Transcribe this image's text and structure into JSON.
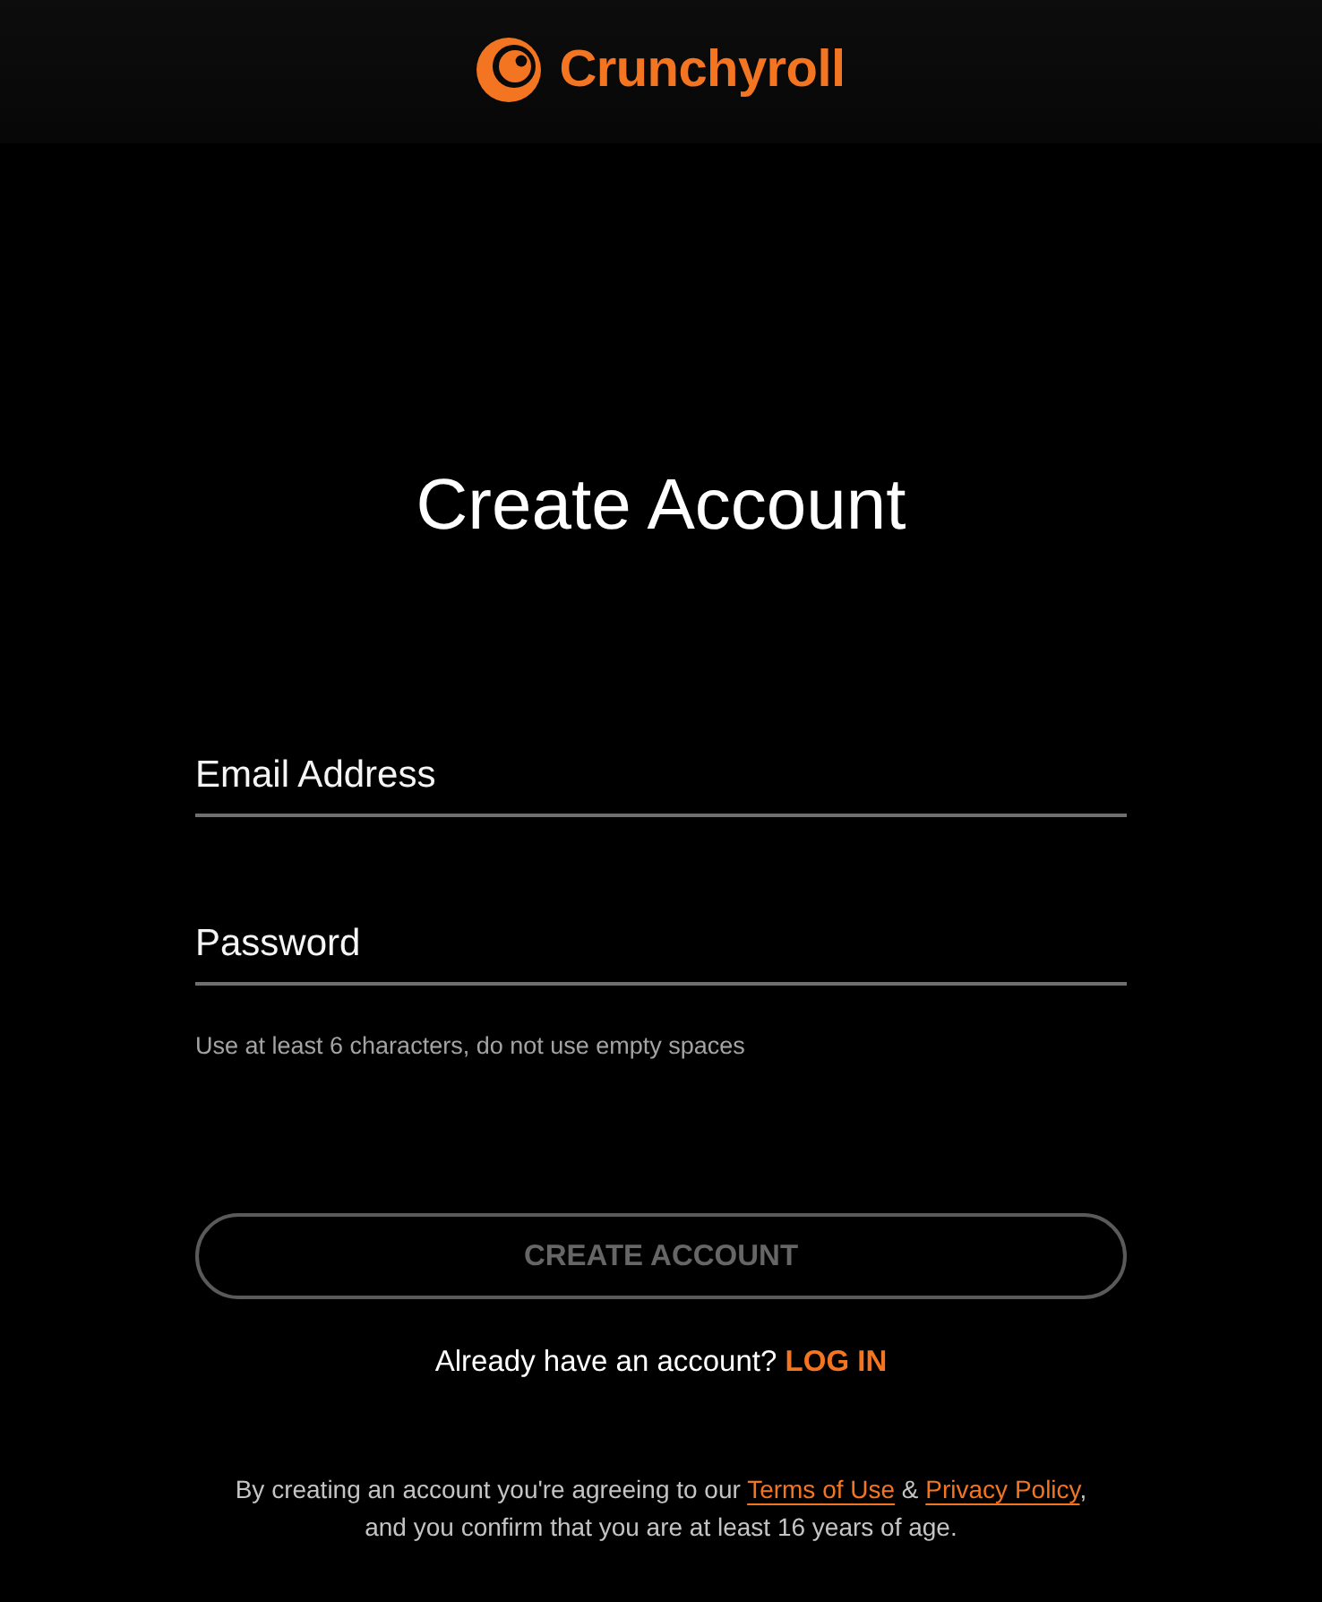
{
  "header": {
    "brand": "Crunchyroll"
  },
  "title": "Create Account",
  "form": {
    "fields": [
      {
        "placeholder": "Email Address"
      },
      {
        "placeholder": "Password"
      }
    ],
    "hint": "Use at least 6 characters, do not use empty spaces"
  },
  "create_button": {
    "label": "CREATE ACCOUNT",
    "disabled": true
  },
  "login_prompt": {
    "text": "Already have an account?",
    "link": "LOG IN"
  },
  "legal": {
    "lines": [
      [
        {
          "kind": "text",
          "text": "By creating an account you're agreeing to our "
        },
        {
          "kind": "link",
          "text": "Terms of Use"
        },
        {
          "kind": "text",
          "text": " & "
        },
        {
          "kind": "link",
          "text": "Privacy Policy"
        },
        {
          "kind": "text",
          "text": ","
        }
      ],
      [
        {
          "kind": "text",
          "text": "and you confirm that you are at least 16 years of age."
        }
      ]
    ]
  }
}
